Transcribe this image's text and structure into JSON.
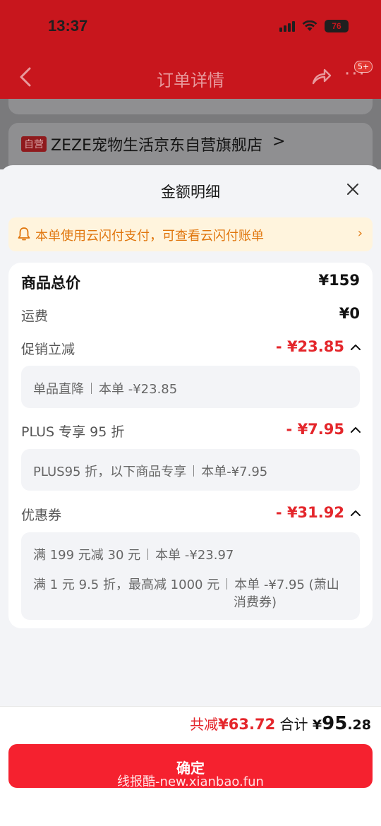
{
  "status_bar": {
    "time": "13:37",
    "battery": "76"
  },
  "navbar": {
    "title": "订单详情",
    "badge": "5+"
  },
  "background": {
    "store_tag": "自营",
    "store_name": "ZEZE宠物生活京东自营旗舰店"
  },
  "sheet": {
    "title": "金额明细",
    "notice": "本单使用云闪付支付，可查看云闪付账单",
    "rows": {
      "goods_total": {
        "label": "商品总价",
        "value": "¥159"
      },
      "shipping": {
        "label": "运费",
        "value": "¥0"
      },
      "promo": {
        "label": "促销立减",
        "value": "- ¥23.85",
        "details": [
          {
            "name": "单品直降",
            "amount": "本单 -¥23.85"
          }
        ]
      },
      "plus": {
        "label": "PLUS 专享 95 折",
        "value": "- ¥7.95",
        "details": [
          {
            "name": "PLUS95 折，以下商品专享",
            "amount": "本单-¥7.95"
          }
        ]
      },
      "coupon": {
        "label": "优惠券",
        "value": "- ¥31.92",
        "details": [
          {
            "name": "满 199 元减 30 元",
            "amount": "本单 -¥23.97"
          },
          {
            "name": "满 1 元 9.5 折，最高减 1000 元",
            "amount": "本单 -¥7.95 (萧山",
            "amount_cont": "消费券)"
          }
        ]
      }
    }
  },
  "footer": {
    "saved_prefix": "共减",
    "saved_amount": "¥63.72",
    "total_prefix": "合计",
    "total_currency": "¥",
    "total_int": "95",
    "total_dec": ".28",
    "confirm": "确定",
    "watermark": "线报酷-new.xianbao.fun"
  }
}
